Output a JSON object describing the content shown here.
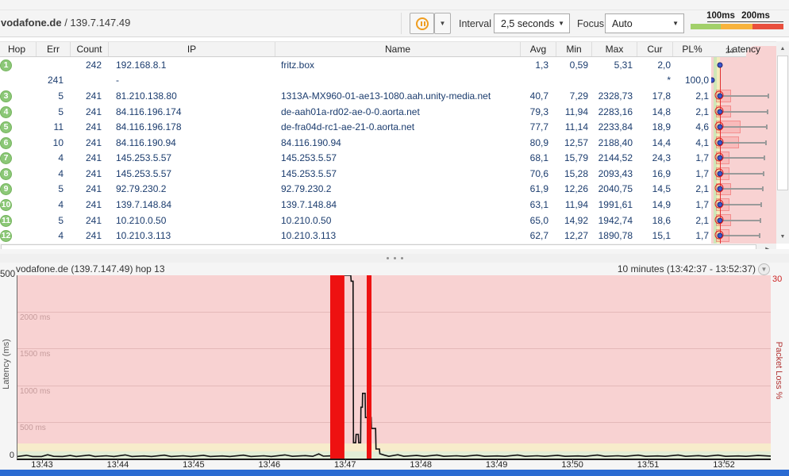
{
  "toolbar": {
    "target_host": "vodafone.de",
    "target_separator": " / ",
    "target_ip": "139.7.147.49",
    "interval_label": "Interval",
    "interval_value": "2,5 seconds",
    "focus_label": "Focus",
    "focus_value": "Auto",
    "legend": {
      "labels": [
        "100ms",
        "200ms"
      ],
      "colors": {
        "good": "#a2d06a",
        "warn": "#f8b33c",
        "bad": "#e94f3d"
      }
    }
  },
  "table": {
    "columns": [
      "Hop",
      "Err",
      "Count",
      "IP",
      "Name",
      "Avg",
      "Min",
      "Max",
      "Cur",
      "PL%",
      "Latency"
    ],
    "latency_header_scale": "24",
    "latency_scale_max": 2430,
    "rows": [
      {
        "hop": "1",
        "err": "",
        "count": "242",
        "ip": "192.168.8.1",
        "name": "fritz.box",
        "avg": "1,3",
        "min": "0,59",
        "max": "5,31",
        "cur": "2,0",
        "pl": ""
      },
      {
        "hop": "",
        "err": "241",
        "count": "",
        "ip": "-",
        "name": "",
        "avg": "",
        "min": "",
        "max": "",
        "cur": "*",
        "pl": "100,0"
      },
      {
        "hop": "3",
        "err": "5",
        "count": "241",
        "ip": "81.210.138.80",
        "name": "1313A-MX960-01-ae13-1080.aah.unity-media.net",
        "avg": "40,7",
        "min": "7,29",
        "max": "2328,73",
        "cur": "17,8",
        "pl": "2,1"
      },
      {
        "hop": "4",
        "err": "5",
        "count": "241",
        "ip": "84.116.196.174",
        "name": "de-aah01a-rd02-ae-0-0.aorta.net",
        "avg": "79,3",
        "min": "11,94",
        "max": "2283,16",
        "cur": "14,8",
        "pl": "2,1"
      },
      {
        "hop": "5",
        "err": "11",
        "count": "241",
        "ip": "84.116.196.178",
        "name": "de-fra04d-rc1-ae-21-0.aorta.net",
        "avg": "77,7",
        "min": "11,14",
        "max": "2233,84",
        "cur": "18,9",
        "pl": "4,6"
      },
      {
        "hop": "6",
        "err": "10",
        "count": "241",
        "ip": "84.116.190.94",
        "name": "84.116.190.94",
        "avg": "80,9",
        "min": "12,57",
        "max": "2188,40",
        "cur": "14,4",
        "pl": "4,1"
      },
      {
        "hop": "7",
        "err": "4",
        "count": "241",
        "ip": "145.253.5.57",
        "name": "145.253.5.57",
        "avg": "68,1",
        "min": "15,79",
        "max": "2144,52",
        "cur": "24,3",
        "pl": "1,7"
      },
      {
        "hop": "8",
        "err": "4",
        "count": "241",
        "ip": "145.253.5.57",
        "name": "145.253.5.57",
        "avg": "70,6",
        "min": "15,28",
        "max": "2093,43",
        "cur": "16,9",
        "pl": "1,7"
      },
      {
        "hop": "9",
        "err": "5",
        "count": "241",
        "ip": "92.79.230.2",
        "name": "92.79.230.2",
        "avg": "61,9",
        "min": "12,26",
        "max": "2040,75",
        "cur": "14,5",
        "pl": "2,1"
      },
      {
        "hop": "10",
        "err": "4",
        "count": "241",
        "ip": "139.7.148.84",
        "name": "139.7.148.84",
        "avg": "63,1",
        "min": "11,94",
        "max": "1991,61",
        "cur": "14,9",
        "pl": "1,7"
      },
      {
        "hop": "11",
        "err": "5",
        "count": "241",
        "ip": "10.210.0.50",
        "name": "10.210.0.50",
        "avg": "65,0",
        "min": "14,92",
        "max": "1942,74",
        "cur": "18,6",
        "pl": "2,1"
      },
      {
        "hop": "12",
        "err": "4",
        "count": "241",
        "ip": "10.210.3.113",
        "name": "10.210.3.113",
        "avg": "62,7",
        "min": "12,27",
        "max": "1890,78",
        "cur": "15,1",
        "pl": "1,7"
      }
    ]
  },
  "chart_data": {
    "type": "line",
    "title": "vodafone.de (139.7.147.49) hop 13",
    "time_window": "10 minutes (13:42:37 - 13:52:37)",
    "ylabel": "Latency (ms)",
    "y2label": "Packet Loss %",
    "ylim": [
      0,
      2500
    ],
    "y2lim": [
      0,
      30
    ],
    "y_top_tick_label": "500",
    "y_bottom_tick_label": "0",
    "y2_top_tick_label": "30",
    "grid_values": [
      2000,
      1500,
      1000,
      500
    ],
    "grid_labels": [
      "2000 ms",
      "1500 ms",
      "1000 ms",
      "500 ms"
    ],
    "x_ticks": [
      "13:43",
      "13:44",
      "13:45",
      "13:46",
      "13:47",
      "13:48",
      "13:49",
      "13:50",
      "13:51",
      "13:52"
    ],
    "line_color": "#111111",
    "loss_color": "#ee1111",
    "packet_loss_bars": [
      {
        "from": 0.4152,
        "to": 0.4341
      },
      {
        "from": 0.4636,
        "to": 0.4699
      }
    ],
    "latency_points": [
      [
        0,
        28
      ],
      [
        0.012,
        44
      ],
      [
        0.02,
        28
      ],
      [
        0.032,
        28
      ],
      [
        0.04,
        52
      ],
      [
        0.048,
        30
      ],
      [
        0.06,
        28
      ],
      [
        0.07,
        42
      ],
      [
        0.078,
        28
      ],
      [
        0.095,
        46
      ],
      [
        0.103,
        28
      ],
      [
        0.118,
        38
      ],
      [
        0.128,
        28
      ],
      [
        0.143,
        50
      ],
      [
        0.152,
        28
      ],
      [
        0.168,
        36
      ],
      [
        0.178,
        28
      ],
      [
        0.195,
        46
      ],
      [
        0.204,
        28
      ],
      [
        0.22,
        38
      ],
      [
        0.23,
        28
      ],
      [
        0.247,
        44
      ],
      [
        0.256,
        28
      ],
      [
        0.272,
        36
      ],
      [
        0.282,
        28
      ],
      [
        0.3,
        46
      ],
      [
        0.31,
        28
      ],
      [
        0.327,
        38
      ],
      [
        0.337,
        28
      ],
      [
        0.355,
        50
      ],
      [
        0.365,
        30
      ],
      [
        0.382,
        40
      ],
      [
        0.392,
        30
      ],
      [
        0.4,
        64
      ],
      [
        0.406,
        32
      ],
      [
        0.414,
        36
      ],
      [
        0.424,
        40
      ],
      [
        0.429,
        42
      ],
      [
        0.4295,
        2500
      ],
      [
        0.4425,
        2500
      ],
      [
        0.443,
        2420
      ],
      [
        0.4455,
        2420
      ],
      [
        0.446,
        215
      ],
      [
        0.449,
        215
      ],
      [
        0.4495,
        330
      ],
      [
        0.4525,
        330
      ],
      [
        0.453,
        215
      ],
      [
        0.4555,
        215
      ],
      [
        0.456,
        700
      ],
      [
        0.4578,
        700
      ],
      [
        0.4582,
        890
      ],
      [
        0.4615,
        890
      ],
      [
        0.462,
        560
      ],
      [
        0.4695,
        560
      ],
      [
        0.47,
        410
      ],
      [
        0.4755,
        410
      ],
      [
        0.476,
        130
      ],
      [
        0.4805,
        130
      ],
      [
        0.481,
        66
      ],
      [
        0.487,
        46
      ],
      [
        0.493,
        30
      ],
      [
        0.505,
        52
      ],
      [
        0.513,
        30
      ],
      [
        0.53,
        42
      ],
      [
        0.54,
        30
      ],
      [
        0.557,
        48
      ],
      [
        0.566,
        30
      ],
      [
        0.583,
        38
      ],
      [
        0.593,
        30
      ],
      [
        0.61,
        46
      ],
      [
        0.62,
        30
      ],
      [
        0.637,
        36
      ],
      [
        0.647,
        30
      ],
      [
        0.664,
        48
      ],
      [
        0.674,
        30
      ],
      [
        0.69,
        38
      ],
      [
        0.7,
        30
      ],
      [
        0.717,
        44
      ],
      [
        0.727,
        30
      ],
      [
        0.744,
        36
      ],
      [
        0.754,
        30
      ],
      [
        0.77,
        48
      ],
      [
        0.78,
        30
      ],
      [
        0.797,
        38
      ],
      [
        0.807,
        30
      ],
      [
        0.824,
        46
      ],
      [
        0.834,
        30
      ],
      [
        0.85,
        36
      ],
      [
        0.86,
        30
      ],
      [
        0.877,
        48
      ],
      [
        0.887,
        30
      ],
      [
        0.904,
        40
      ],
      [
        0.914,
        30
      ],
      [
        0.93,
        46
      ],
      [
        0.94,
        30
      ],
      [
        0.957,
        36
      ],
      [
        0.967,
        30
      ],
      [
        0.983,
        42
      ],
      [
        1,
        34
      ]
    ]
  }
}
